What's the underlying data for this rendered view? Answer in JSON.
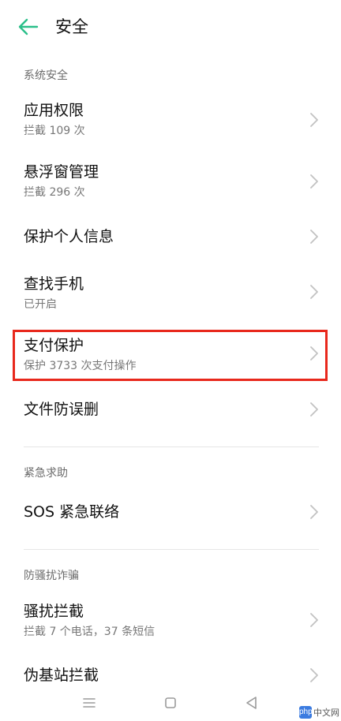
{
  "header": {
    "title": "安全"
  },
  "sections": {
    "system": {
      "header": "系统安全",
      "items": [
        {
          "title": "应用权限",
          "subtitle": "拦截 109 次"
        },
        {
          "title": "悬浮窗管理",
          "subtitle": "拦截 296 次"
        },
        {
          "title": "保护个人信息"
        },
        {
          "title": "查找手机",
          "subtitle": "已开启"
        },
        {
          "title": "支付保护",
          "subtitle": "保护 3733 次支付操作"
        },
        {
          "title": "文件防误删"
        }
      ]
    },
    "emergency": {
      "header": "紧急求助",
      "items": [
        {
          "title": "SOS 紧急联络"
        }
      ]
    },
    "anti_fraud": {
      "header": "防骚扰诈骗",
      "items": [
        {
          "title": "骚扰拦截",
          "subtitle": "拦截 7 个电话，37 条短信"
        },
        {
          "title": "伪基站拦截"
        }
      ]
    }
  },
  "watermark": {
    "badge": "php",
    "text": "中文网"
  },
  "colors": {
    "accent": "#2bbf8a",
    "highlight": "#e8281c"
  },
  "icons": {
    "back": "arrow-left-icon",
    "chevron": "chevron-right-icon",
    "nav_menu": "menu-icon",
    "nav_home": "home-square-icon",
    "nav_back": "back-triangle-icon"
  }
}
